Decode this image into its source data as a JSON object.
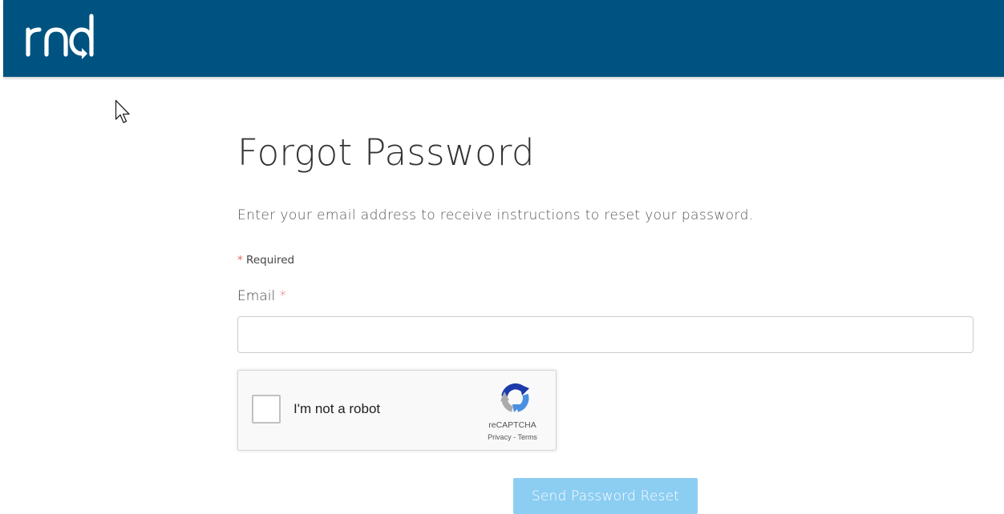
{
  "header": {
    "logo_text": "rnd",
    "background_color": "#005380"
  },
  "form": {
    "title": "Forgot Password",
    "instructions": "Enter your email address to receive instructions to reset your password.",
    "required_marker": "*",
    "required_note": "Required",
    "email_label": "Email",
    "email_value": "",
    "email_placeholder": ""
  },
  "recaptcha": {
    "checkbox_label": "I'm not a robot",
    "brand": "reCAPTCHA",
    "privacy_link": "Privacy",
    "separator": "-",
    "terms_link": "Terms",
    "logo_icon": "recaptcha-logo-icon"
  },
  "actions": {
    "submit_label": "Send Password Reset",
    "submit_color": "#8ccef2"
  },
  "colors": {
    "required_asterisk": "#e06666"
  }
}
